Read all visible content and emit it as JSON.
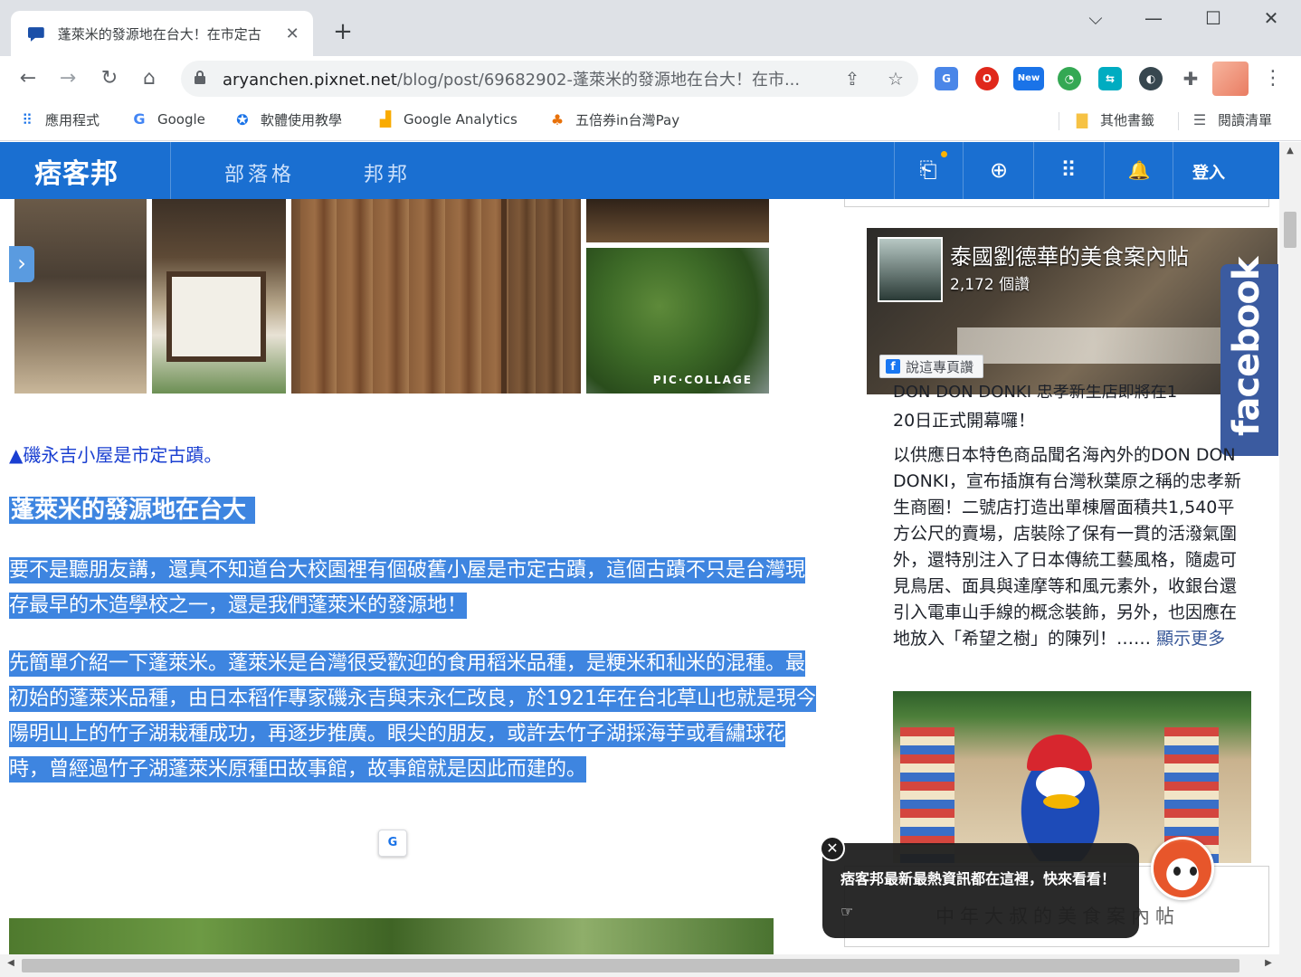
{
  "browser": {
    "tab": {
      "title": "蓬萊米的發源地在台大！在市定古",
      "close_glyph": "✕"
    },
    "new_tab_glyph": "+",
    "window_controls": {
      "dropdown": "⌵",
      "minimize": "—",
      "maximize": "☐",
      "close": "✕"
    },
    "toolbar": {
      "back": "←",
      "forward": "→",
      "reload": "↻",
      "home": "⌂",
      "url_host": "aryanchen.pixnet.net",
      "url_path": "/blog/post/69682902-蓬萊米的發源地在台大！在市...",
      "lock_glyph": "🔒",
      "share_glyph": "⇪",
      "star_glyph": "☆",
      "ext_new_badge": "New",
      "menu_glyph": "⋮"
    },
    "bookmarks": [
      {
        "label": "應用程式",
        "icon": "apps-grid-icon",
        "glyph": "⠿"
      },
      {
        "label": "Google",
        "icon": "google-icon",
        "glyph": "G"
      },
      {
        "label": "軟體使用教學",
        "icon": "software-icon",
        "glyph": "✪"
      },
      {
        "label": "Google Analytics",
        "icon": "analytics-icon",
        "glyph": "▟"
      },
      {
        "label": "五倍券in台灣Pay",
        "icon": "pay-icon",
        "glyph": "♣"
      }
    ],
    "bookmarks_right": [
      {
        "label": "其他書籤",
        "icon": "folder-icon",
        "glyph": "▇"
      },
      {
        "label": "閱讀清單",
        "icon": "reading-list-icon",
        "glyph": "☰"
      }
    ]
  },
  "site": {
    "logo": "痞客邦",
    "nav": [
      "部落格",
      "邦邦"
    ],
    "icons": {
      "bookmark": "⎗",
      "search": "⊕",
      "apps": "⠿",
      "bell": "🔔"
    },
    "login": "登入",
    "side_arrow": "›"
  },
  "article": {
    "collage_tag": "PIC·COLLAGE",
    "caption": "▲磯永吉小屋是市定古蹟。",
    "heading": "蓬萊米的發源地在台大",
    "paragraph1": "要不是聽朋友講，還真不知道台大校園裡有個破舊小屋是市定古蹟，這個古蹟不只是台灣現存最早的木造學校之一，還是我們蓬萊米的發源地！",
    "paragraph2": "先簡單介紹一下蓬萊米。蓬萊米是台灣很受歡迎的食用稻米品種，是粳米和秈米的混種。最初始的蓬萊米品種，由日本稻作專家磯永吉與末永仁改良，於1921年在台北草山也就是現今陽明山上的竹子湖栽種成功，再逐步推廣。眼尖的朋友，或許去竹子湖採海芋或看繡球花時，曾經過竹子湖蓬萊米原種田故事館，故事館就是因此而建的。",
    "translate_mini": "G"
  },
  "sidebar": {
    "fb_page_name": "泰國劉德華的美食案內帖",
    "fb_likes": "2,172 個讚",
    "fb_follow": "說這專頁讚",
    "fb_tab": "facebook",
    "post_cut": "DON DON DONKI 忠孝新生店即將在1",
    "post_date": "20日正式開幕囉！",
    "post_body": "以供應日本特色商品聞名海內外的DON DON DONKI，宣布插旗有台灣秋葉原之稱的忠孝新生商圈！二號店打造出單棟層面積共1,540平方公尺的賣場，店裝除了保有一貫的活潑氣圍外，還特別注入了日本傳統工藝風格，隨處可見鳥居、面具與達摩等和風元素外，收銀台還引入電車山手線的概念裝飾，另外，也因應在地放入「希望之樹」的陳列！……",
    "see_more": "顯示更多",
    "box2_title": "中年大叔的美食案內帖"
  },
  "popup": {
    "text": "痞客邦最新最熱資訊都在這裡，快來看看！☞",
    "close": "✕"
  }
}
